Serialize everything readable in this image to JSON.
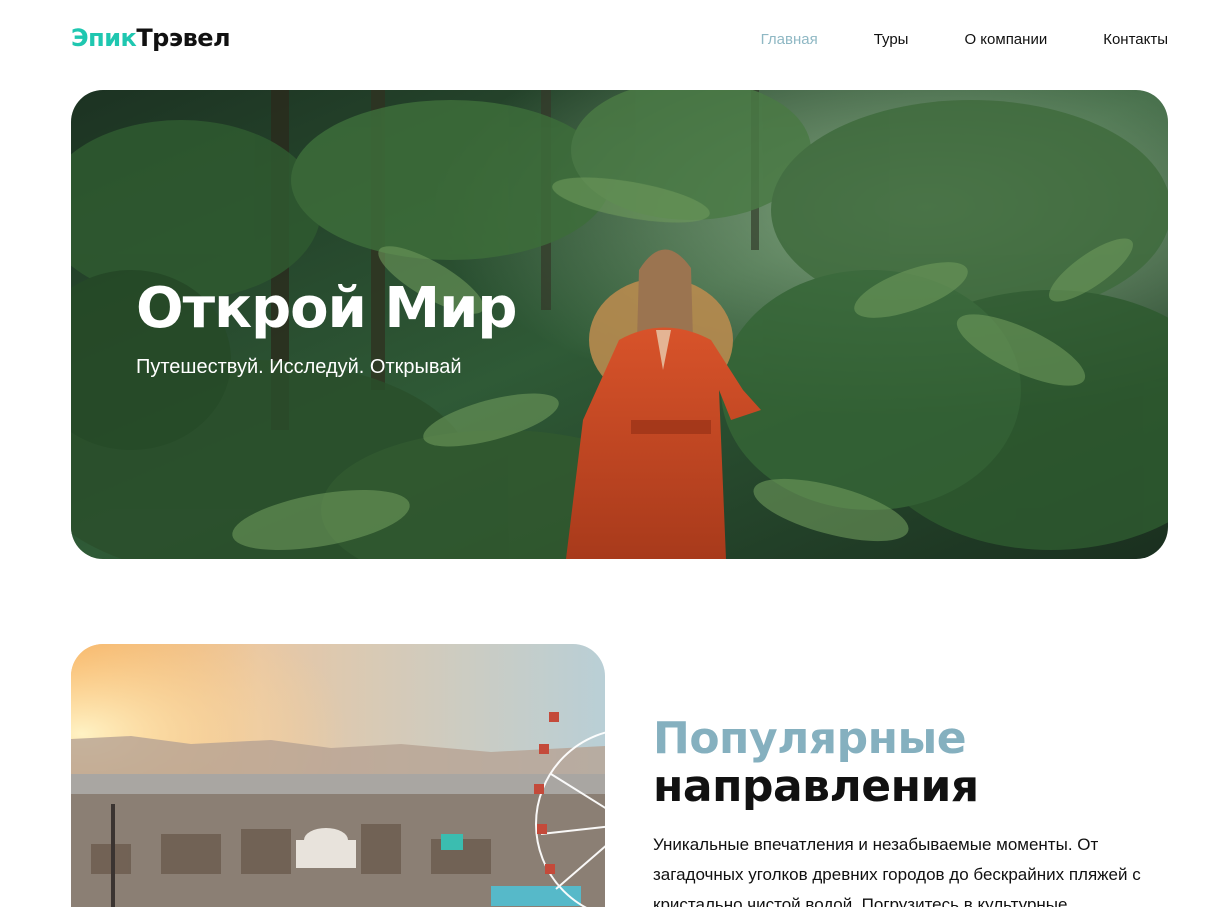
{
  "header": {
    "logo_accent": "Эпик",
    "logo_main": "Трэвел",
    "nav": [
      {
        "label": "Главная",
        "active": true
      },
      {
        "label": "Туры",
        "active": false
      },
      {
        "label": "О компании",
        "active": false
      },
      {
        "label": "Контакты",
        "active": false
      }
    ]
  },
  "hero": {
    "title": "Открой Мир",
    "subtitle": "Путешествуй. Исследуй. Открывай"
  },
  "destinations": {
    "title_line1": "Популярные",
    "title_line2": "направления",
    "text": "Уникальные впечатления и незабываемые моменты. От загадочных уголков древних городов до бескрайних пляжей с кристально чистой водой. Погрузитесь в культурные"
  },
  "colors": {
    "logo_accent": "#1fc7b0",
    "nav_active": "#8fb8c4",
    "section_accent": "#85b0bf"
  }
}
